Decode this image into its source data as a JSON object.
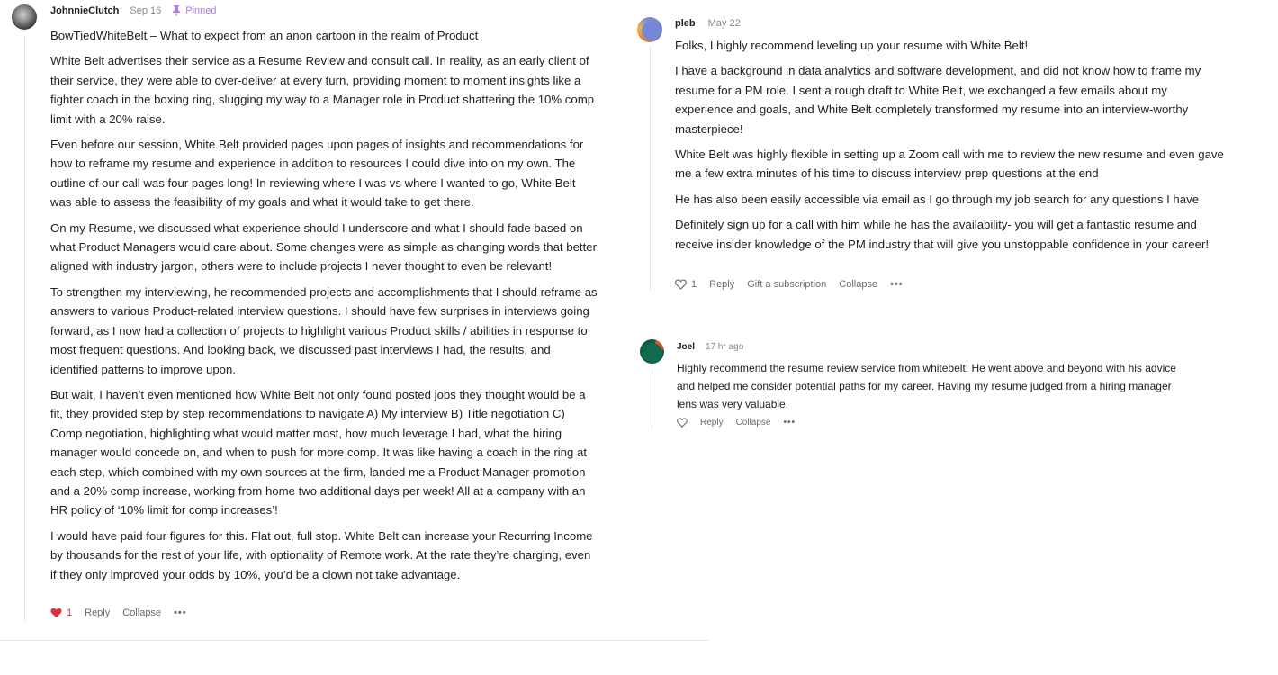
{
  "comments": [
    {
      "author": "JohnnieClutch",
      "date": "Sep 16",
      "pinned_label": "Pinned",
      "paragraphs": [
        "BowTiedWhiteBelt – What to expect from an anon cartoon in the realm of Product",
        "White Belt advertises their service as a Resume Review and consult call. In reality, as an early client of their service, they were able to over-deliver at every turn, providing moment to moment insights like a fighter coach in the boxing ring, slugging my way to a Manager role in Product shattering the 10% comp limit with a 20% raise.",
        "Even before our session, White Belt provided pages upon pages of insights and recommendations for how to reframe my resume and experience in addition to resources I could dive into on my own. The outline of our call was four pages long! In reviewing where I was vs where I wanted to go, White Belt was able to assess the feasibility of my goals and what it would take to get there.",
        "On my Resume, we discussed what experience should I underscore and what I should fade based on what Product Managers would care about. Some changes were as simple as changing words that better aligned with industry jargon, others were to include projects I never thought to even be relevant!",
        "To strengthen my interviewing, he recommended projects and accomplishments that I should reframe as answers to various Product-related interview questions. I should have few surprises in interviews going forward, as I now had a collection of projects to highlight various Product skills / abilities in response to most frequent questions. And looking back, we discussed past interviews I had, the results, and identified patterns to improve upon.",
        "But wait, I haven’t even mentioned how White Belt not only found posted jobs they thought would be a fit, they provided step by step recommendations to navigate A) My interview B) Title negotiation C) Comp negotiation, highlighting what would matter most, how much leverage I had, what the hiring manager would concede on, and when to push for more comp. It was like having a coach in the ring at each step, which combined with my own sources at the firm, landed me a Product Manager promotion and a 20% comp increase, working from home two additional days per week! All at a company with an HR policy of ‘10% limit for comp increases’!",
        "I would have paid four figures for this. Flat out, full stop. White Belt can increase your Recurring Income by thousands for the rest of your life, with optionality of Remote work. At the rate they’re charging, even if they only improved your odds by 10%, you’d be a clown not take advantage."
      ],
      "likes": "1",
      "liked": true,
      "actions": [
        "Reply",
        "Collapse"
      ],
      "more": "•••"
    },
    {
      "author": "pleb",
      "date": "May 22",
      "paragraphs": [
        "Folks, I highly recommend leveling up your resume with White Belt!",
        "I have a background in data analytics and software development, and did not know how to frame my resume for a PM role. I sent a rough draft to White Belt, we exchanged a few emails about my experience and goals, and White Belt completely transformed my resume into an interview-worthy masterpiece!",
        "White Belt was highly flexible in setting up a Zoom call with me to review the new resume and even gave me a few extra minutes of his time to discuss interview prep questions at the end",
        "He has also been easily accessible via email as I go through my job search for any questions I have",
        "Definitely sign up for a call with him while he has the availability- you will get a fantastic resume and receive insider knowledge of the PM industry that will give you unstoppable confidence in your career!"
      ],
      "likes": "1",
      "liked": false,
      "actions": [
        "Reply",
        "Gift a subscription",
        "Collapse"
      ],
      "more": "•••"
    },
    {
      "author": "Joel",
      "date": "17 hr ago",
      "paragraphs": [
        "Highly recommend the resume review service from whitebelt! He went above and beyond with his advice and helped me consider potential paths for my career. Having my resume judged from a hiring manager lens was very valuable."
      ],
      "likes": "",
      "liked": false,
      "actions": [
        "Reply",
        "Collapse"
      ],
      "more": "•••"
    }
  ],
  "colors": {
    "liked_heart": "#e0303a",
    "pinned": "#b27bea",
    "muted": "#8a8a8a"
  },
  "icons": [
    "pin-icon",
    "heart-icon",
    "more-icon"
  ]
}
